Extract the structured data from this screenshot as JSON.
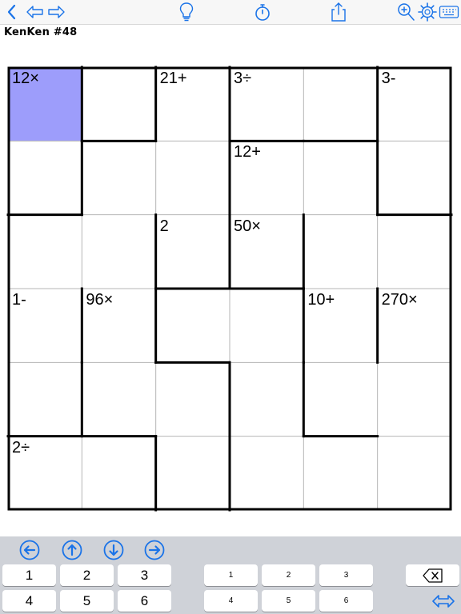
{
  "toolbar": {
    "icons": [
      "back-icon",
      "undo-arrow-icon",
      "redo-arrow-icon",
      "hint-lightbulb-icon",
      "timer-icon",
      "share-icon",
      "zoom-icon",
      "settings-gear-icon",
      "keyboard-icon"
    ],
    "accent_color": "#1a73e8"
  },
  "puzzle": {
    "title": "KenKen #48",
    "size": 6,
    "selected_cell": [
      0,
      0
    ],
    "selected_color": "#9d9dfb",
    "cells": [
      {
        "row": 0,
        "col": 0,
        "clue": "12×"
      },
      {
        "row": 0,
        "col": 1,
        "clue": ""
      },
      {
        "row": 0,
        "col": 2,
        "clue": "21+"
      },
      {
        "row": 0,
        "col": 3,
        "clue": "3÷"
      },
      {
        "row": 0,
        "col": 4,
        "clue": ""
      },
      {
        "row": 0,
        "col": 5,
        "clue": "3-"
      },
      {
        "row": 1,
        "col": 0,
        "clue": ""
      },
      {
        "row": 1,
        "col": 1,
        "clue": ""
      },
      {
        "row": 1,
        "col": 2,
        "clue": ""
      },
      {
        "row": 1,
        "col": 3,
        "clue": "12+"
      },
      {
        "row": 1,
        "col": 4,
        "clue": ""
      },
      {
        "row": 1,
        "col": 5,
        "clue": ""
      },
      {
        "row": 2,
        "col": 0,
        "clue": ""
      },
      {
        "row": 2,
        "col": 1,
        "clue": ""
      },
      {
        "row": 2,
        "col": 2,
        "clue": "2"
      },
      {
        "row": 2,
        "col": 3,
        "clue": "50×"
      },
      {
        "row": 2,
        "col": 4,
        "clue": ""
      },
      {
        "row": 2,
        "col": 5,
        "clue": ""
      },
      {
        "row": 3,
        "col": 0,
        "clue": "1-"
      },
      {
        "row": 3,
        "col": 1,
        "clue": "96×"
      },
      {
        "row": 3,
        "col": 2,
        "clue": ""
      },
      {
        "row": 3,
        "col": 3,
        "clue": ""
      },
      {
        "row": 3,
        "col": 4,
        "clue": "10+"
      },
      {
        "row": 3,
        "col": 5,
        "clue": "270×"
      },
      {
        "row": 4,
        "col": 0,
        "clue": ""
      },
      {
        "row": 4,
        "col": 1,
        "clue": ""
      },
      {
        "row": 4,
        "col": 2,
        "clue": ""
      },
      {
        "row": 4,
        "col": 3,
        "clue": ""
      },
      {
        "row": 4,
        "col": 4,
        "clue": ""
      },
      {
        "row": 4,
        "col": 5,
        "clue": ""
      },
      {
        "row": 5,
        "col": 0,
        "clue": "2÷"
      },
      {
        "row": 5,
        "col": 1,
        "clue": ""
      },
      {
        "row": 5,
        "col": 2,
        "clue": ""
      },
      {
        "row": 5,
        "col": 3,
        "clue": ""
      },
      {
        "row": 5,
        "col": 4,
        "clue": ""
      },
      {
        "row": 5,
        "col": 5,
        "clue": ""
      }
    ],
    "cage_borders": {
      "horizontal": [
        {
          "row": 1,
          "col": 1
        },
        {
          "row": 1,
          "col": 3
        },
        {
          "row": 1,
          "col": 4
        },
        {
          "row": 2,
          "col": 0
        },
        {
          "row": 2,
          "col": 5
        },
        {
          "row": 3,
          "col": 2
        },
        {
          "row": 3,
          "col": 3
        },
        {
          "row": 4,
          "col": 2
        },
        {
          "row": 5,
          "col": 0
        },
        {
          "row": 5,
          "col": 1
        },
        {
          "row": 5,
          "col": 4
        }
      ],
      "vertical": [
        {
          "row": 0,
          "col": 1
        },
        {
          "row": 0,
          "col": 2
        },
        {
          "row": 0,
          "col": 3
        },
        {
          "row": 0,
          "col": 5
        },
        {
          "row": 1,
          "col": 1
        },
        {
          "row": 1,
          "col": 3
        },
        {
          "row": 1,
          "col": 5
        },
        {
          "row": 2,
          "col": 2
        },
        {
          "row": 2,
          "col": 3
        },
        {
          "row": 2,
          "col": 4
        },
        {
          "row": 3,
          "col": 1
        },
        {
          "row": 3,
          "col": 2
        },
        {
          "row": 3,
          "col": 4
        },
        {
          "row": 3,
          "col": 5
        },
        {
          "row": 4,
          "col": 1
        },
        {
          "row": 4,
          "col": 3
        },
        {
          "row": 4,
          "col": 4
        },
        {
          "row": 5,
          "col": 2
        },
        {
          "row": 5,
          "col": 3
        }
      ]
    }
  },
  "keyboard": {
    "arrows": [
      "left-arrow-icon",
      "up-arrow-icon",
      "down-arrow-icon",
      "right-arrow-icon"
    ],
    "big_keys": [
      "1",
      "2",
      "3",
      "4",
      "5",
      "6"
    ],
    "small_keys": [
      "1",
      "2",
      "3",
      "4",
      "5",
      "6"
    ],
    "backspace_icon": "backspace-icon",
    "swap_icon": "swap-keyboard-icon"
  }
}
